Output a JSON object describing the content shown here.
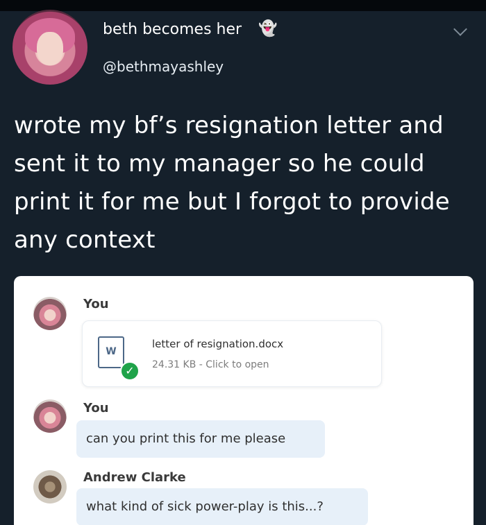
{
  "tweet": {
    "display_name": "beth becomes her",
    "emoji": "👻",
    "handle": "@bethmayashley",
    "text": "wrote my bf’s resignation letter and sent it to my manager so he could print it for me but I forgot to provide any context"
  },
  "chat": {
    "messages": [
      {
        "sender": "You"
      },
      {
        "sender": "You",
        "text": "can you print this for me please"
      },
      {
        "sender": "Andrew Clarke",
        "text": "what kind of sick power-play is this...?"
      }
    ],
    "attachment": {
      "filename": "letter of resignation.docx",
      "meta": "24.31 KB - Click to open",
      "icon_letter": "W"
    }
  }
}
